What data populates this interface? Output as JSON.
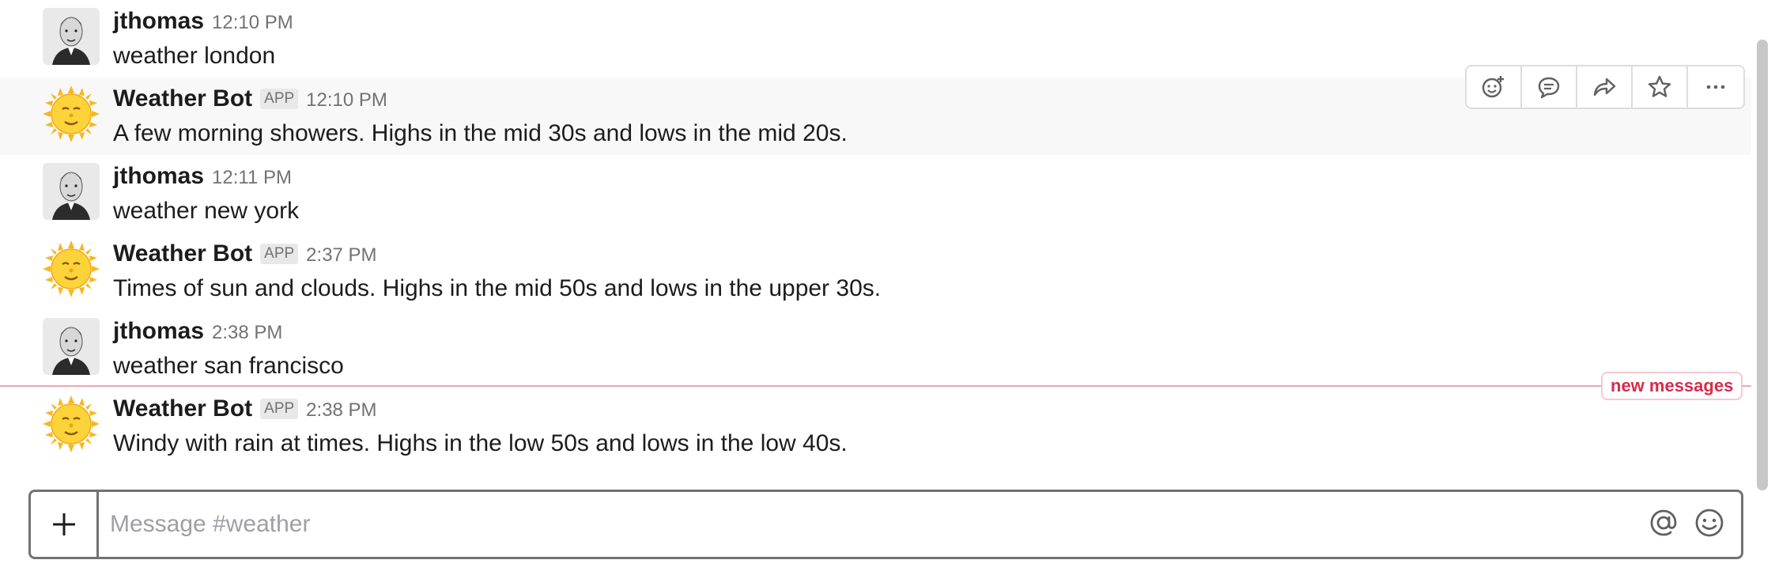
{
  "channel": "weather",
  "messages": [
    {
      "author": "jthomas",
      "time": "12:10 PM",
      "text": "weather london",
      "bot": false
    },
    {
      "author": "Weather Bot",
      "badge": "APP",
      "time": "12:10 PM",
      "text": "A few morning showers. Highs in the mid 30s and lows in the mid 20s.",
      "bot": true
    },
    {
      "author": "jthomas",
      "time": "12:11 PM",
      "text": "weather new york",
      "bot": false
    },
    {
      "author": "Weather Bot",
      "badge": "APP",
      "time": "2:37 PM",
      "text": "Times of sun and clouds. Highs in the mid 50s and lows in the upper 30s.",
      "bot": true
    },
    {
      "author": "jthomas",
      "time": "2:38 PM",
      "text": "weather san francisco",
      "bot": false
    },
    {
      "author": "Weather Bot",
      "badge": "APP",
      "time": "2:38 PM",
      "text": "Windy with rain at times. Highs in the low 50s and lows in the low 40s.",
      "bot": true
    }
  ],
  "message_actions": {
    "icons": [
      "add-reaction-icon",
      "thread-reply-icon",
      "share-icon",
      "star-icon",
      "more-icon"
    ]
  },
  "new_messages_label": "new messages",
  "composer": {
    "placeholder": "Message #weather",
    "value": ""
  },
  "colors": {
    "divider": "#f0a5b2",
    "new_messages_text": "#d72b4a",
    "hover_bg": "#f8f8f8"
  }
}
